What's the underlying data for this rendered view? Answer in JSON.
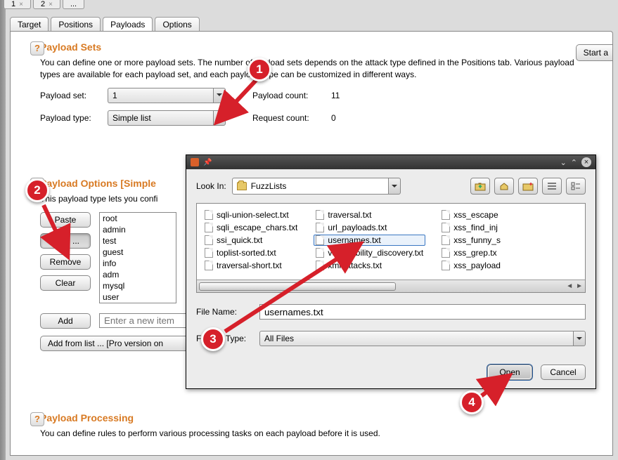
{
  "miniTabs": [
    "1",
    "2",
    "..."
  ],
  "tabs": {
    "target": "Target",
    "positions": "Positions",
    "payloads": "Payloads",
    "options": "Options"
  },
  "startBtn": "Start a",
  "sections": {
    "sets": {
      "title": "Payload Sets",
      "desc": "You can define one or more payload sets. The number of payload sets depends on the attack type defined in the Positions tab. Various payload types are available for each payload set, and each payload type can be customized in different ways.",
      "setLabel": "Payload set:",
      "setValue": "1",
      "typeLabel": "Payload type:",
      "typeValue": "Simple list",
      "countLabel": "Payload count:",
      "countValue": "11",
      "reqLabel": "Request count:",
      "reqValue": "0"
    },
    "opts": {
      "title": "Payload Options [Simple",
      "desc": "This payload type lets you confi",
      "buttons": {
        "paste": "Paste",
        "load": "Load ...",
        "remove": "Remove",
        "clear": "Clear",
        "add": "Add",
        "addFromList": "Add from list ... [Pro version on"
      },
      "placeholder": "Enter a new item",
      "items": [
        "root",
        "admin",
        "test",
        "guest",
        "info",
        "adm",
        "mysql",
        "user"
      ]
    },
    "proc": {
      "title": "Payload Processing",
      "desc": "You can define rules to perform various processing tasks on each payload before it is used."
    }
  },
  "dialog": {
    "lookIn": "Look In:",
    "folder": "FuzzLists",
    "cols": [
      [
        "sqli-union-select.txt",
        "sqli_escape_chars.txt",
        "ssi_quick.txt",
        "toplist-sorted.txt",
        "traversal-short.txt"
      ],
      [
        "traversal.txt",
        "url_payloads.txt",
        "usernames.txt",
        "vulnerability_discovery.txt",
        "xml-attacks.txt"
      ],
      [
        "xss_escape",
        "xss_find_inj",
        "xss_funny_s",
        "xss_grep.tx",
        "xss_payload"
      ]
    ],
    "selectedIndex": {
      "col": 1,
      "row": 2
    },
    "fileNameLabel": "File Name:",
    "fileNameValue": "usernames.txt",
    "fileTypeLabel": "Files of Type:",
    "fileTypeValue": "All Files",
    "open": "Open",
    "cancel": "Cancel"
  },
  "markers": {
    "m1": "1",
    "m2": "2",
    "m3": "3",
    "m4": "4"
  }
}
